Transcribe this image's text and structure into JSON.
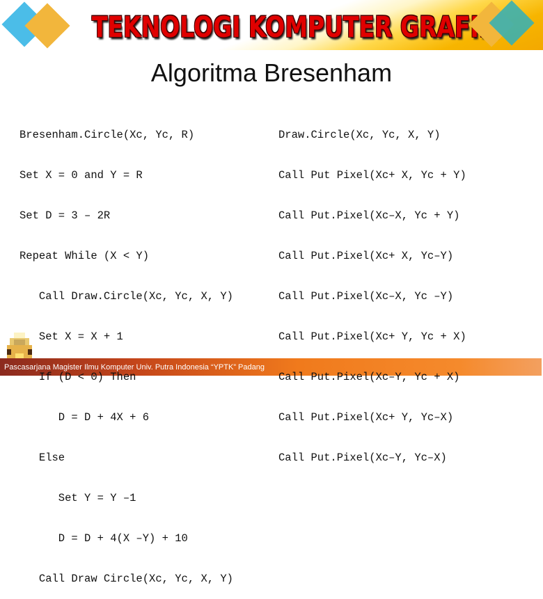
{
  "banner": {
    "title": "TEKNOLOGI KOMPUTER GRAFIK",
    "colors": {
      "blue": "#4bbde8",
      "yellow": "#f2b63c",
      "teal": "#3bb0b0",
      "title_red": "#e00000"
    }
  },
  "slide": {
    "title": "Algoritma Bresenham"
  },
  "left_code": [
    "Bresenham.Circle(Xc, Yc, R)",
    "Set X = 0 and Y = R",
    "Set D = 3 – 2R",
    "Repeat While (X < Y)",
    "   Call Draw.Circle(Xc, Yc, X, Y)",
    "   Set X = X + 1",
    "   If (D < 0) Then",
    "      D = D + 4X + 6",
    "   Else",
    "      Set Y = Y –1",
    "      D = D + 4(X –Y) + 10",
    "   Call Draw Circle(Xc, Yc, X, Y)"
  ],
  "right_code": [
    "Draw.Circle(Xc, Yc, X, Y)",
    "Call Put Pixel(Xc+ X, Yc + Y)",
    "Call Put.Pixel(Xc–X, Yc + Y)",
    "Call Put.Pixel(Xc+ X, Yc–Y)",
    "Call Put.Pixel(Xc–X, Yc –Y)",
    "Call Put.Pixel(Xc+ Y, Yc + X)",
    "Call Put.Pixel(Xc–Y, Yc + X)",
    "Call Put.Pixel(Xc+ Y, Yc–X)",
    "Call Put.Pixel(Xc–Y, Yc–X)"
  ],
  "footer": {
    "text": "Pascasarjana Magister Ilmu Komputer  Univ. Putra Indonesia “YPTK” Padang"
  }
}
